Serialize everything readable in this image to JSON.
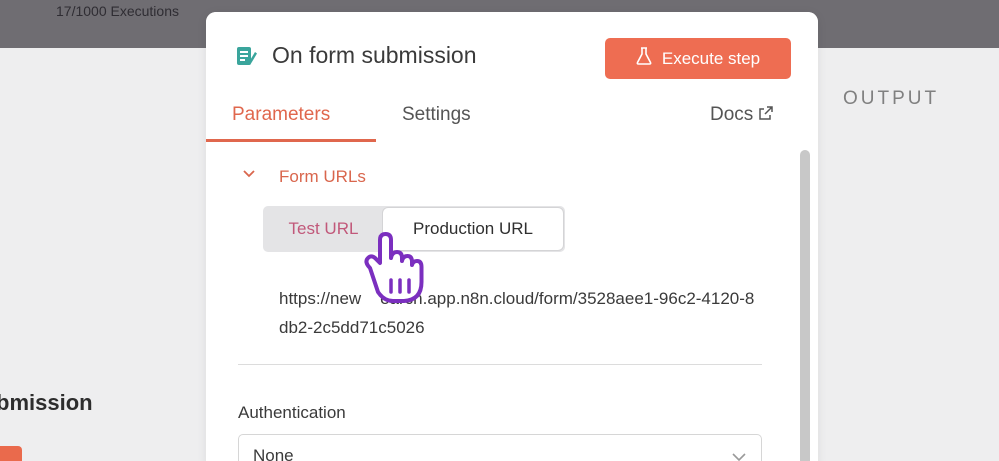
{
  "topbar": {
    "executions_text": "17/1000 Executions"
  },
  "background": {
    "output_label": "OUTPUT",
    "left_title_fragment": "bmission"
  },
  "panel": {
    "title": "On form submission",
    "execute_button": "Execute step",
    "tabs": [
      {
        "label": "Parameters",
        "active": true
      },
      {
        "label": "Settings",
        "active": false
      }
    ],
    "docs_label": "Docs",
    "form_urls": {
      "section_label": "Form URLs",
      "toggle": {
        "test_label": "Test URL",
        "production_label": "Production URL",
        "selected": "Production URL"
      },
      "url_text": "https://new    earch.app.n8n.cloud/form/3528aee1-96c2-4120-8db2-2c5dd71c5026"
    },
    "authentication": {
      "label": "Authentication",
      "value": "None"
    }
  },
  "colors": {
    "accent": "#ee6d52",
    "tab_active": "#e0674d",
    "cursor": "#7b2fbf"
  },
  "icons": {
    "node": "form-icon",
    "execute": "flask-icon",
    "docs": "external-link-icon",
    "section": "chevron-down-icon",
    "select": "chevron-down-icon",
    "pointer": "hand-pointer-icon"
  }
}
